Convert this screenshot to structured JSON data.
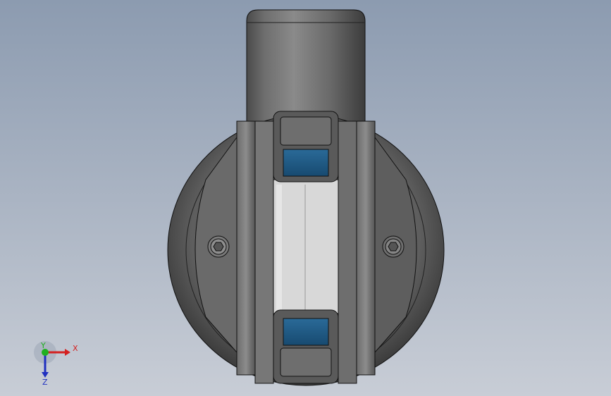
{
  "viewport": {
    "background_top": "#8C9BB0",
    "background_bottom": "#C5CBD5"
  },
  "model": {
    "body_color": "#5A5A5A",
    "body_highlight": "#8A8A8A",
    "window_color": "#D6D6D6",
    "pad_color": "#1E5A85"
  },
  "triad": {
    "x_label": "X",
    "y_label": "Y",
    "z_label": "Z",
    "x_color": "#D42020",
    "y_color": "#20B020",
    "z_color": "#2030C0"
  }
}
